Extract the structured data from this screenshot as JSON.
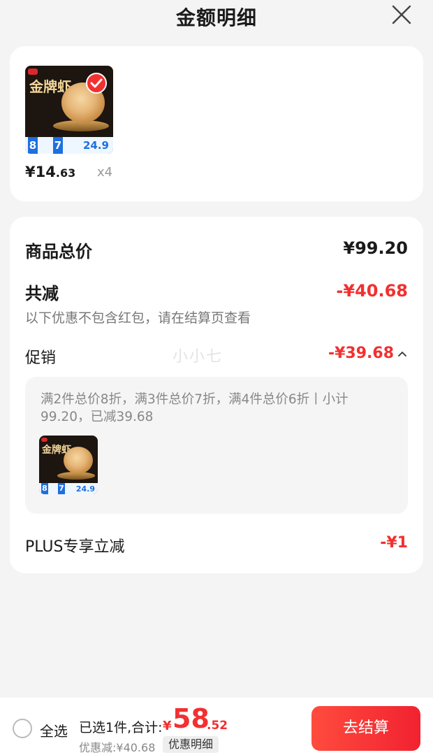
{
  "header": {
    "title": "金额明细"
  },
  "product": {
    "brand": "金牌虾",
    "price_symbol": "¥",
    "price_int": "14",
    "price_dec": ".63",
    "quantity": "x4",
    "strip_a": "8",
    "strip_b": "7",
    "strip_price": "24.9"
  },
  "summary": {
    "goods_total_label": "商品总价",
    "goods_total_value": "¥99.20",
    "discount_label": "共减",
    "discount_value": "-¥40.68",
    "note": "以下优惠不包含红包，请在结算页查看",
    "promo_label": "促销",
    "promo_value": "-¥39.68",
    "watermark": "小小七",
    "promo_desc": "满2件总价8折，满3件总价7折，满4件总价6折丨小计99.20，已减39.68",
    "plus_label": "PLUS专享立减",
    "plus_value": "-¥1"
  },
  "bottom_bar": {
    "select_all": "全选",
    "selected_info": "已选1件,合计:",
    "total_symbol": "¥",
    "total_int": "58",
    "total_dec": ".52",
    "saved": "优惠减:¥40.68",
    "detail_button": "优惠明细",
    "checkout_button": "去结算"
  },
  "colors": {
    "accent": "#f23030",
    "background": "#f4f4f4",
    "card": "#ffffff"
  }
}
